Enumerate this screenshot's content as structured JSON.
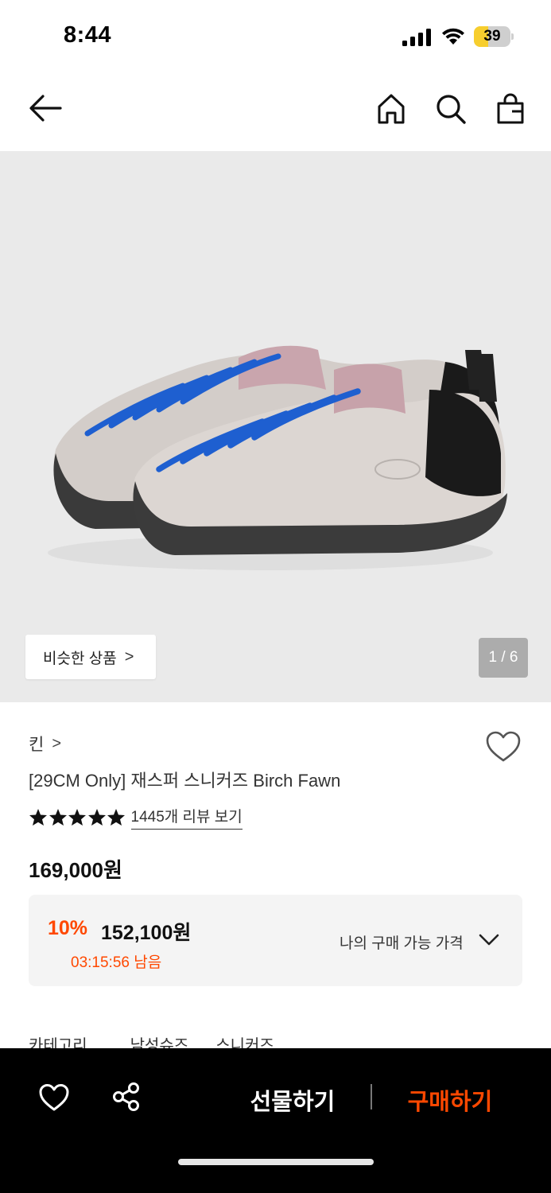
{
  "status_bar": {
    "time": "8:44",
    "battery": "39",
    "battery_level": 0.39
  },
  "hero": {
    "counter": "1 / 6",
    "similar_label": "비슷한 상품",
    "similar_chevron": ">"
  },
  "product": {
    "brand": "킨",
    "brand_chevron": ">",
    "title": "[29CM Only] 재스퍼 스니커즈 Birch Fawn",
    "rating_stars": 5,
    "review_link": "1445개 리뷰 보기",
    "original_price": "169,000원"
  },
  "discount": {
    "rate": "10%",
    "price": "152,100원",
    "timer": "03:15:56 남음",
    "my_price_label": "나의 구매 가능 가격"
  },
  "category": {
    "label": "카테고리",
    "values": [
      "남성슈즈",
      "스니커즈"
    ]
  },
  "bottom_bar": {
    "gift_label": "선물하기",
    "buy_label": "구매하기"
  },
  "colors": {
    "accent": "#ff4800",
    "bottom_bar": "#000000",
    "hero_bg": "#eaeaea",
    "battery": "#f7ce2e"
  },
  "icons": [
    "back-arrow-icon",
    "home-icon",
    "search-icon",
    "shopping-bag-icon",
    "heart-icon",
    "share-icon",
    "star-icon",
    "chevron-down-icon"
  ]
}
